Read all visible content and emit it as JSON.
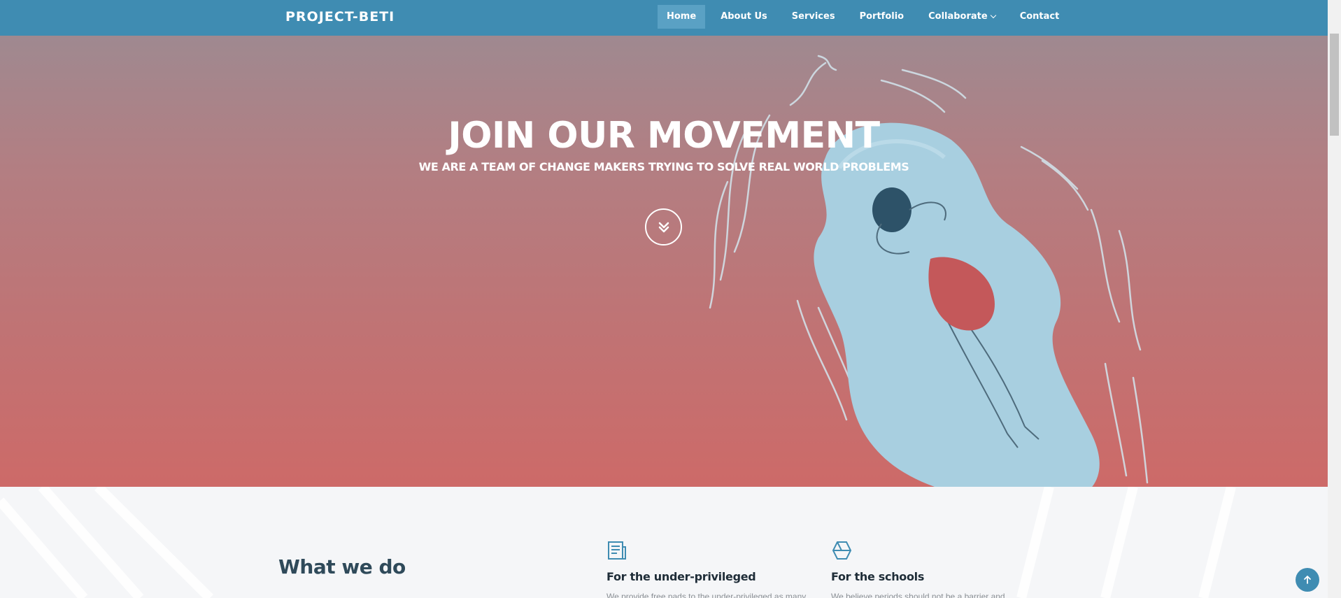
{
  "header": {
    "logo": "PROJECT-BETI",
    "nav": [
      {
        "label": "Home",
        "active": true
      },
      {
        "label": "About Us"
      },
      {
        "label": "Services"
      },
      {
        "label": "Portfolio"
      },
      {
        "label": "Collaborate",
        "has_dropdown": true
      },
      {
        "label": "Contact"
      }
    ]
  },
  "hero": {
    "title": "JOIN OUR MOVEMENT",
    "subtitle": "WE ARE A TEAM OF CHANGE MAKERS TRYING TO SOLVE REAL WORLD PROBLEMS",
    "scroll_icon": "chevron-double-down-icon"
  },
  "what_we_do": {
    "title": "What we do",
    "services": [
      {
        "icon": "document-icon",
        "title": "For the under-privileged",
        "text": "We provide free pads to the under-privileged as many"
      },
      {
        "icon": "cube-icon",
        "title": "For the schools",
        "text": "We believe periods should not be a barrier and"
      }
    ]
  },
  "back_to_top_icon": "arrow-up-icon",
  "colors": {
    "header": "#3f8cb2",
    "nav_active": "#5aa1c4",
    "hero_top": "#9f8990",
    "hero_bottom": "#cd6a68",
    "accent": "#3f8cb2"
  }
}
